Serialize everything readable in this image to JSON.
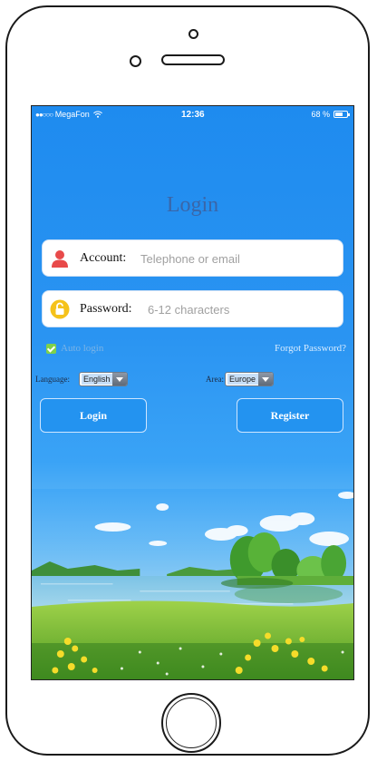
{
  "status_bar": {
    "carrier": "MegaFon",
    "time": "12:36",
    "battery": "68 %",
    "battery_level": 0.68
  },
  "login": {
    "title": "Login",
    "account": {
      "label": "Account:",
      "placeholder": "Telephone or email",
      "value": ""
    },
    "password": {
      "label": "Password:",
      "placeholder": "6-12 characters",
      "value": ""
    },
    "auto_login": {
      "label": "Auto login",
      "checked": true
    },
    "forgot_password": "Forgot Password?",
    "language": {
      "label": "Language:",
      "selected": "English"
    },
    "area": {
      "label": "Area:",
      "selected": "Europe"
    },
    "login_button": "Login",
    "register_button": "Register"
  },
  "colors": {
    "screen_blue": "#1e8bef",
    "button_border": "#cfe6ff",
    "checkbox_green": "#7fd14a",
    "account_icon_red": "#e84a4a",
    "password_icon_yellow": "#f5c21b"
  },
  "icons": {
    "account": "user-icon",
    "password": "lock-icon"
  }
}
